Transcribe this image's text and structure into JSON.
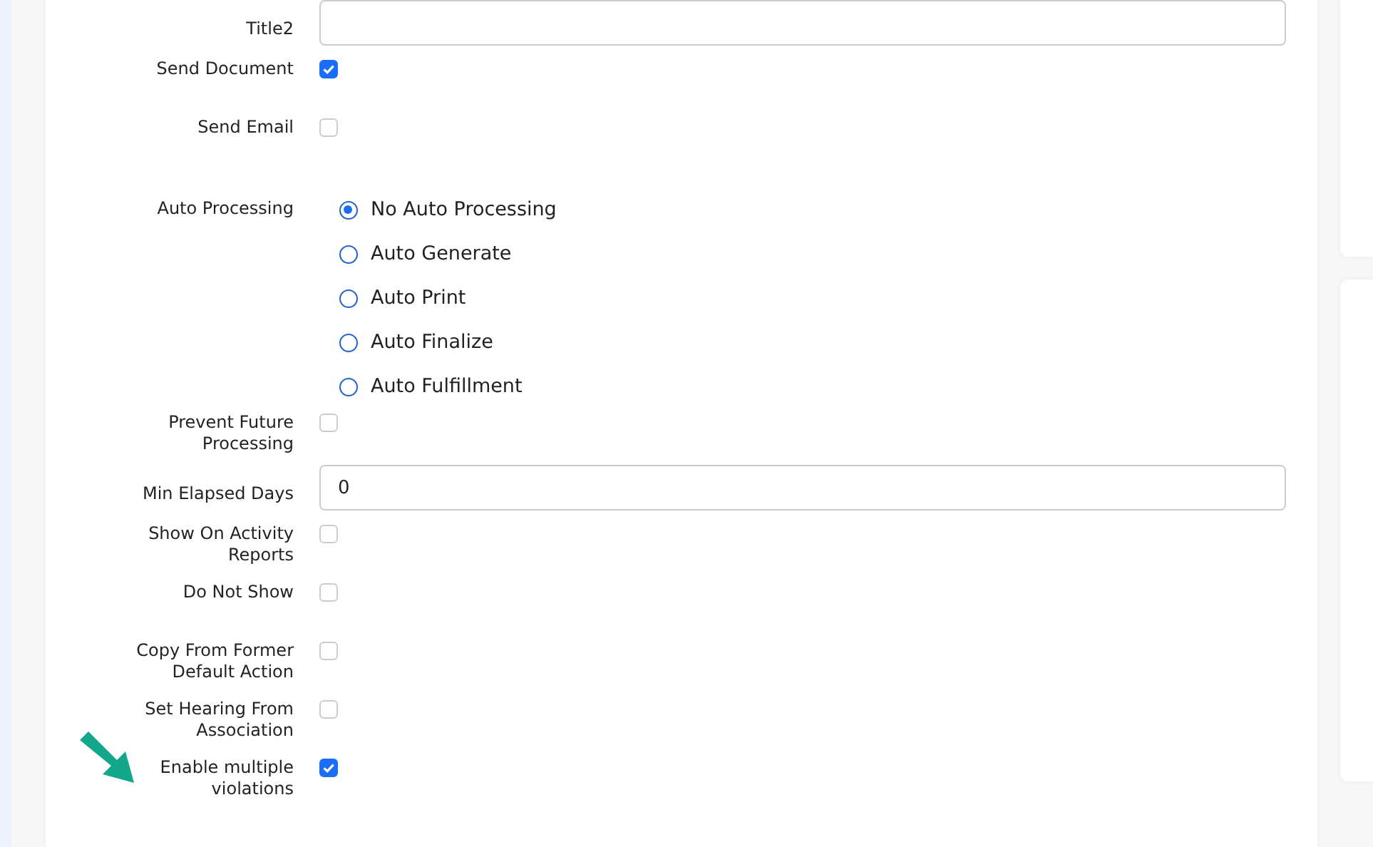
{
  "form": {
    "rows": [
      {
        "kind": "text",
        "label": "Title2",
        "value": ""
      },
      {
        "kind": "checkbox",
        "label": "Send Document",
        "checked": true
      },
      {
        "kind": "checkbox",
        "label": "Send Email",
        "checked": false
      },
      {
        "kind": "radio",
        "label": "Auto Processing",
        "options": [
          {
            "label": "No Auto Processing",
            "selected": true
          },
          {
            "label": "Auto Generate",
            "selected": false
          },
          {
            "label": "Auto Print",
            "selected": false
          },
          {
            "label": "Auto Finalize",
            "selected": false
          },
          {
            "label": "Auto Fulfillment",
            "selected": false
          }
        ]
      },
      {
        "kind": "checkbox",
        "label": "Prevent Future Processing",
        "checked": false
      },
      {
        "kind": "text",
        "label": "Min Elapsed Days",
        "value": "0"
      },
      {
        "kind": "checkbox",
        "label": "Show On Activity Reports",
        "checked": false
      },
      {
        "kind": "checkbox",
        "label": "Do Not Show",
        "checked": false
      },
      {
        "kind": "checkbox",
        "label": "Copy From Former Default Action",
        "checked": false
      },
      {
        "kind": "checkbox",
        "label": "Set Hearing From Association",
        "checked": false
      },
      {
        "kind": "checkbox",
        "label": "Enable multiple violations",
        "checked": true
      }
    ]
  }
}
